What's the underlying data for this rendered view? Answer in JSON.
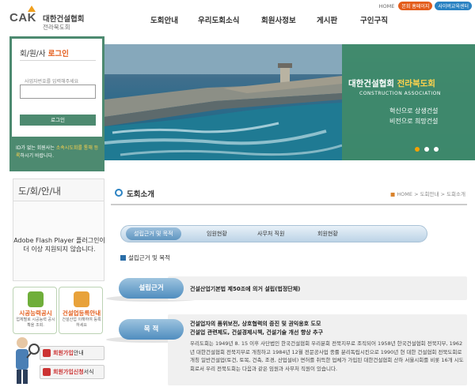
{
  "header": {
    "logo_abbr": "CAK",
    "logo_name": "대한건설협회",
    "logo_sub": "전라북도회",
    "util_home": "HOME",
    "util_link1": "본회 홈페이지",
    "util_link2": "사이버교육센터",
    "nav": [
      "도회안내",
      "우리도회소식",
      "회원사정보",
      "게시판",
      "구인구직"
    ]
  },
  "hero": {
    "title_a": "대한건설협회 ",
    "title_b": "전라북도회",
    "subtitle_en": "CONSTRUCTION ASSOCIATION",
    "line1": "혁신으로 상생건설",
    "line2": "비전으로 희망건설"
  },
  "login": {
    "title_a": "회/원/사 ",
    "title_b": "로그인",
    "id_label": "사업자번호를 입력해주세요",
    "button": "로그인",
    "note_a": "ID가 없는 회원사는 ",
    "note_b": "소속시도회를 통해 등록",
    "note_c": "하시기 바랍니다."
  },
  "sidebar": {
    "title": "도/회/안/내",
    "flash_msg": "Adobe Flash Player 플러그인이 더 이상 지원되지 않습니다.",
    "tile1_title": "시공능력공시",
    "tile1_desc": "업체별로 시공능력 공시확을 조회.",
    "tile2_title": "건설업등록안내",
    "tile2_desc": "건설산업 이해하여 등록하세요",
    "btn1_a": "회원가입",
    "btn1_b": "안내",
    "btn2_a": "회원가입신청",
    "btn2_b": "서식"
  },
  "content": {
    "title": "도회소개",
    "crumb_home": "HOME",
    "crumb_rest": " > 도회안내 > 도회소개",
    "tabs": [
      "설립근거 및 목적",
      "임원현황",
      "사무처 직원",
      "회원현황"
    ],
    "section": "설립근거 및 목적",
    "row1_label": "설립근거",
    "row1_text": "건설산업기본법 제50조에 의거 설립(법정단체)",
    "row2_label": "목 적",
    "row2_line1": "건설업자의 품위보전, 상호협력의 증진 및 권익옹호 도모",
    "row2_line2": "건설업 관련제도, 건설경제시책, 건설기술 개선 향상 추구",
    "paragraph": "우리도회는 1949년 8. 15 이후 사단법인 한국건설협회 우리분회 전북지부로 조직되어 1958년 한국건설협회 전북지부, 1962년 대한건설협회 전북지부로 개칭하고 1984년 12월 전문공사업 종률 분리독립시킨으로 1990년 현 대한 건설협회 전북도회로 개칭 일반건설업(토건, 토목, 건축, 조경, 산업설비) 면허를 취득한 업체가 가입된 대한건설협회 산하 서울시회를 비롯 16개 시도회로서 우리 전북도회는 다음과 같은 임원과 사무처 직원이 있습니다."
  },
  "colors": {
    "green": "#4d8a70",
    "accent_orange": "#e35d1c",
    "blue": "#2b82c2"
  }
}
